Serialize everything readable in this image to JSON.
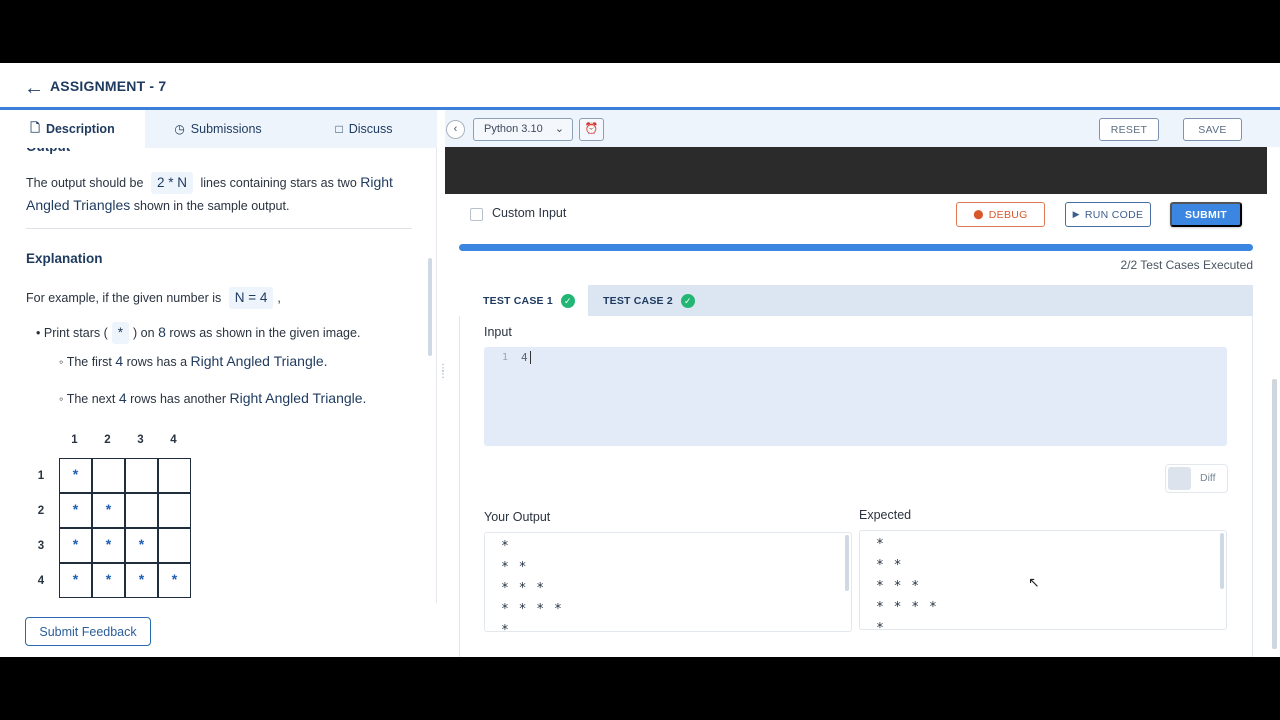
{
  "header": {
    "back_icon": "arrow-left-icon",
    "title": "ASSIGNMENT - 7"
  },
  "left_tabs": [
    {
      "label": "Description",
      "icon": "file-icon"
    },
    {
      "label": "Submissions",
      "icon": "clock-icon"
    },
    {
      "label": "Discuss",
      "icon": "chat-icon"
    }
  ],
  "description": {
    "output_partial_heading": "Output",
    "output_text_1": "The output should be",
    "output_expr": "2 * N",
    "output_text_2": "lines containing stars as two",
    "output_highlight": "Right",
    "output_highlight_2": "Angled Triangles",
    "output_text_3": "shown in the sample output.",
    "explanation_heading": "Explanation",
    "example_text": "For example, if the given number is",
    "example_expr": "N = 4",
    "example_comma": ",",
    "bullet_1_pre": "Print stars (",
    "bullet_1_star": "*",
    "bullet_1_mid": ") on",
    "bullet_1_num": "8",
    "bullet_1_post": "rows as shown in the given image.",
    "sub_1_pre": "The first",
    "sub_1_num": "4",
    "sub_1_mid": "rows has a",
    "sub_1_hl": "Right Angled Triangle.",
    "sub_2_pre": "The next",
    "sub_2_num": "4",
    "sub_2_mid": "rows has another",
    "sub_2_hl": "Right Angled Triangle.",
    "grid": {
      "col_headers": [
        "1",
        "2",
        "3",
        "4"
      ],
      "row_headers": [
        "1",
        "2",
        "3",
        "4"
      ],
      "cell_symbol": "*"
    }
  },
  "feedback_button": "Submit Feedback",
  "toolbar": {
    "collapse_icon": "chevron-left-icon",
    "language": "Python 3.10",
    "language_chevron": "chevron-down-icon",
    "alarm_icon": "alarm-icon",
    "reset_label": "RESET",
    "save_label": "SAVE"
  },
  "run_panel": {
    "custom_input_label": "Custom Input",
    "debug_label": "DEBUG",
    "run_label": "RUN CODE",
    "submit_label": "SUBMIT",
    "progress": 1.0,
    "executed_text": "2/2 Test Cases Executed",
    "test_cases": [
      {
        "label": "TEST CASE 1",
        "status": "passed"
      },
      {
        "label": "TEST CASE 2",
        "status": "passed"
      }
    ],
    "input_label": "Input",
    "input_line_number": "1",
    "input_value": "4",
    "diff_label": "Diff",
    "your_output_label": "Your Output",
    "expected_label": "Expected",
    "your_output_lines": [
      "*",
      "* *",
      "* * *",
      "* * * *",
      "*"
    ],
    "expected_lines": [
      "*",
      "* *",
      "* * *",
      "* * * *",
      "*"
    ]
  },
  "colors": {
    "accent": "#3a86e0",
    "success": "#22b573",
    "debug": "#d9582b"
  }
}
